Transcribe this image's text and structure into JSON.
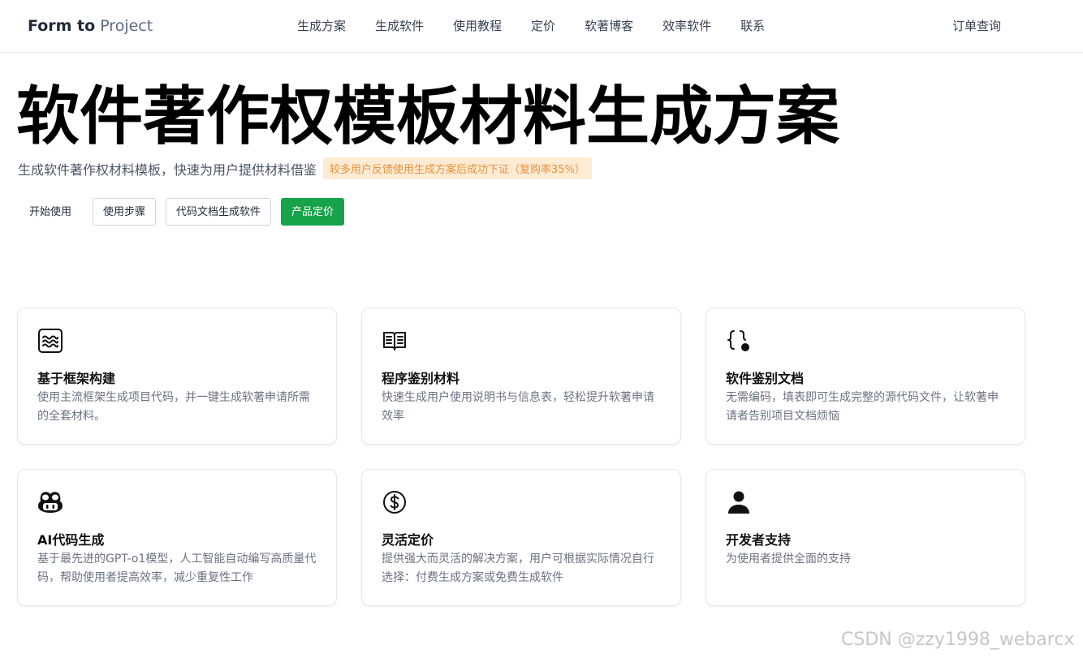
{
  "header": {
    "brand_bold": "Form to",
    "brand_light": "Project",
    "nav": [
      "生成方案",
      "生成软件",
      "使用教程",
      "定价",
      "软著博客",
      "效率软件",
      "联系"
    ],
    "order_query": "订单查询"
  },
  "hero": {
    "title": "软件著作权模板材料生成方案",
    "subtitle": "生成软件著作权材料模板，快速为用户提供材料借鉴",
    "badge": "较多用户反馈使用生成方案后成功下证（复购率35%）",
    "buttons": {
      "start": "开始使用",
      "steps": "使用步骤",
      "code_doc": "代码文档生成软件",
      "pricing": "产品定价"
    }
  },
  "features": [
    {
      "icon": "waves-frame-icon",
      "title": "基于框架构建",
      "text": "使用主流框架生成项目代码，并一键生成软著申请所需的全套材料。"
    },
    {
      "icon": "book-open-icon",
      "title": "程序鉴别材料",
      "text": "快速生成用户使用说明书与信息表，轻松提升软著申请效率"
    },
    {
      "icon": "braces-dot-icon",
      "title": "软件鉴别文档",
      "text": "无需编码，填表即可生成完整的源代码文件，让软著申请者告别项目文档烦恼"
    },
    {
      "icon": "copilot-icon",
      "title": "AI代码生成",
      "text": "基于最先进的GPT-o1模型，人工智能自动编写高质量代码，帮助使用者提高效率，减少重复性工作"
    },
    {
      "icon": "dollar-circle-icon",
      "title": "灵活定价",
      "text": "提供强大而灵活的解决方案，用户可根据实际情况自行选择：付费生成方案或免费生成软件"
    },
    {
      "icon": "user-icon",
      "title": "开发者支持",
      "text": "为使用者提供全面的支持"
    }
  ],
  "watermark": "CSDN @zzy1998_webarcx",
  "colors": {
    "accent_green": "#16a34a",
    "badge_bg": "#fdebd3",
    "badge_text": "#e8913a"
  }
}
